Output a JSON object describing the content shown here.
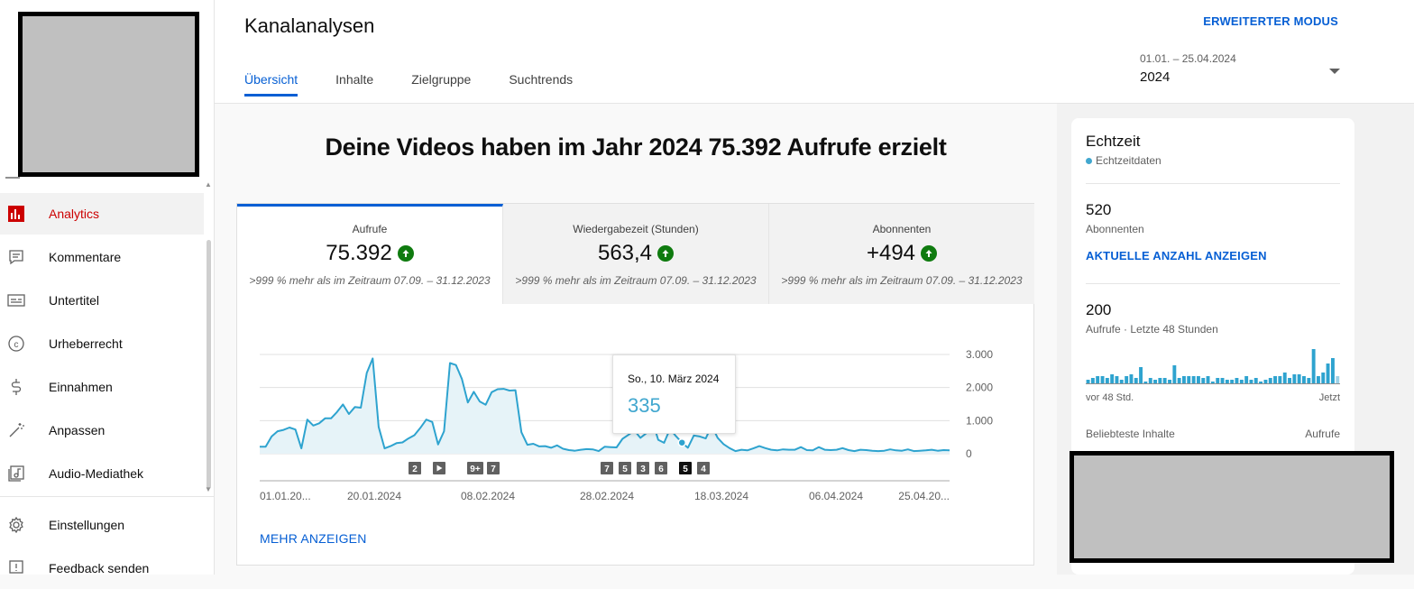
{
  "sidebar": {
    "items": [
      {
        "label": "Analytics",
        "icon": "analytics-icon",
        "active": true
      },
      {
        "label": "Kommentare",
        "icon": "comments-icon"
      },
      {
        "label": "Untertitel",
        "icon": "subtitles-icon"
      },
      {
        "label": "Urheberrecht",
        "icon": "copyright-icon"
      },
      {
        "label": "Einnahmen",
        "icon": "dollar-icon"
      },
      {
        "label": "Anpassen",
        "icon": "magic-wand-icon"
      },
      {
        "label": "Audio-Mediathek",
        "icon": "audio-library-icon"
      }
    ],
    "bottom": [
      {
        "label": "Einstellungen",
        "icon": "gear-icon"
      },
      {
        "label": "Feedback senden",
        "icon": "feedback-icon"
      }
    ],
    "accent": "#cc0000"
  },
  "header": {
    "title": "Kanalanalysen",
    "advanced_mode": "ERWEITERTER MODUS",
    "tabs": [
      {
        "label": "Übersicht",
        "active": true
      },
      {
        "label": "Inhalte"
      },
      {
        "label": "Zielgruppe"
      },
      {
        "label": "Suchtrends"
      }
    ],
    "date_range": "01.01. – 25.04.2024",
    "date_selected": "2024"
  },
  "main": {
    "headline": "Deine Videos haben im Jahr 2024 75.392 Aufrufe erzielt",
    "metrics": [
      {
        "label": "Aufrufe",
        "value": "75.392",
        "compare": ">999 % mehr als im Zeitraum 07.09. – 31.12.2023",
        "active": true
      },
      {
        "label": "Wiedergabezeit (Stunden)",
        "value": "563,4",
        "compare": ">999 % mehr als im Zeitraum 07.09. – 31.12.2023"
      },
      {
        "label": "Abonnenten",
        "value": "+494",
        "compare": ">999 % mehr als im Zeitraum 07.09. – 31.12.2023"
      }
    ],
    "more_link": "MEHR ANZEIGEN",
    "tooltip": {
      "date": "So., 10. März 2024",
      "value": "335"
    },
    "markers": [
      "2",
      "play",
      "9+",
      "7",
      "7",
      "5",
      "3",
      "6",
      "5",
      "4"
    ]
  },
  "chart_data": {
    "type": "area",
    "xlabel": "",
    "ylabel": "",
    "x_ticks": [
      "01.01.20...",
      "20.01.2024",
      "08.02.2024",
      "28.02.2024",
      "18.03.2024",
      "06.04.2024",
      "25.04.20..."
    ],
    "y_ticks": [
      "0",
      "1.000",
      "2.000",
      "3.000"
    ],
    "ylim": [
      0,
      3000
    ],
    "grid": true,
    "color": "#2ea3cf",
    "series": [
      {
        "values": [
          210,
          210,
          520,
          680,
          720,
          790,
          730,
          160,
          1030,
          850,
          920,
          1070,
          1070,
          1260,
          1490,
          1200,
          1410,
          1390,
          2440,
          2880,
          810,
          160,
          230,
          320,
          340,
          460,
          560,
          780,
          1030,
          960,
          280,
          680,
          2740,
          2680,
          2260,
          1550,
          1870,
          1580,
          1480,
          1860,
          1950,
          1960,
          1910,
          1920,
          650,
          270,
          300,
          220,
          230,
          180,
          250,
          150,
          110,
          90,
          120,
          140,
          130,
          80,
          210,
          200,
          190,
          450,
          570,
          700,
          480,
          620,
          1000,
          420,
          330,
          750,
          530,
          335,
          180,
          550,
          520,
          460,
          850,
          480,
          290,
          170,
          80,
          120,
          100,
          160,
          230,
          170,
          120,
          100,
          130,
          120,
          120,
          200,
          110,
          100,
          200,
          120,
          110,
          120,
          170,
          110,
          80,
          120,
          110,
          90,
          80,
          90,
          130,
          100,
          90,
          130,
          80,
          90,
          100,
          120,
          90,
          110,
          100
        ]
      }
    ]
  },
  "realtime": {
    "title": "Echtzeit",
    "subtitle": "Echtzeitdaten",
    "subscribers_value": "520",
    "subscribers_label": "Abonnenten",
    "show_count": "AKTUELLE ANZAHL ANZEIGEN",
    "views_value": "200",
    "views_label": "Aufrufe · Letzte 48 Stunden",
    "axis_left": "vor 48 Std.",
    "axis_right": "Jetzt",
    "popular_label": "Beliebteste Inhalte",
    "popular_col": "Aufrufe",
    "bars": [
      2,
      3,
      4,
      4,
      3,
      5,
      4,
      2,
      4,
      5,
      3,
      9,
      1,
      3,
      2,
      3,
      3,
      2,
      10,
      3,
      4,
      4,
      4,
      4,
      3,
      4,
      1,
      3,
      3,
      2,
      2,
      3,
      2,
      4,
      2,
      3,
      1,
      2,
      3,
      4,
      4,
      6,
      3,
      5,
      5,
      4,
      3,
      19,
      4,
      6,
      11,
      14,
      4
    ]
  }
}
